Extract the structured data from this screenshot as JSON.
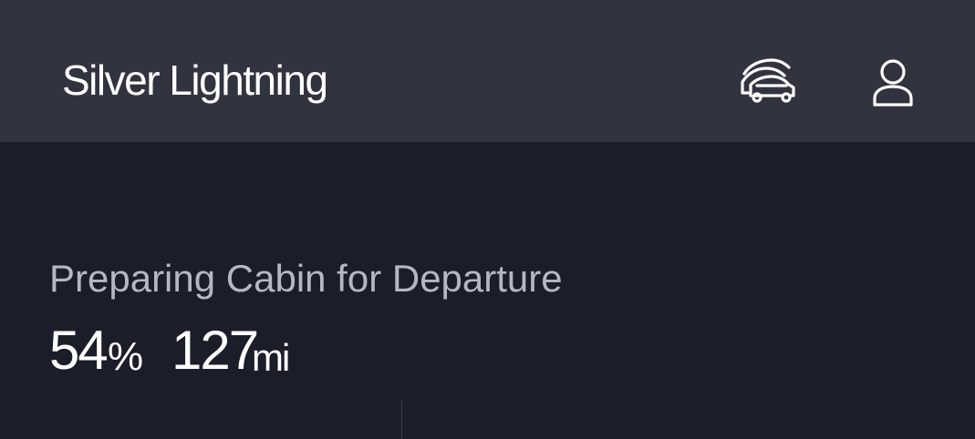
{
  "header": {
    "vehicle_name": "Silver Lightning",
    "garage_icon": "car-garage-icon",
    "account_icon": "person-icon"
  },
  "status": {
    "title": "Preparing Cabin for Departure",
    "charge_value": "54",
    "charge_unit": "%",
    "range_value": "127",
    "range_unit": "mi"
  },
  "colors": {
    "header_bg": "#31333f",
    "body_bg": "#1b1d29",
    "primary_text": "#ffffff",
    "secondary_text": "#b6b7c1"
  }
}
